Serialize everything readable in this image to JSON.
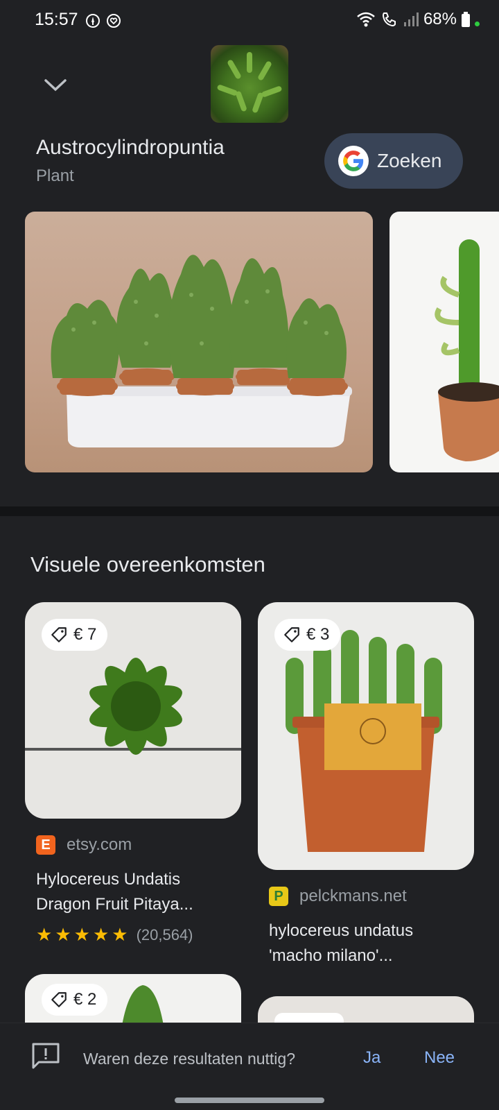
{
  "status_bar": {
    "time": "15:57",
    "battery_pct": "68%",
    "icons": [
      "notification-icon",
      "heart-icon",
      "wifi-icon",
      "wifi-calling-icon",
      "signal-icon",
      "battery-icon"
    ]
  },
  "entity": {
    "title": "Austrocylindropuntia",
    "subtitle": "Plant",
    "search_label": "Zoeken"
  },
  "visual_matches": {
    "title": "Visuele overeenkomsten",
    "items": [
      {
        "price": "€ 7",
        "source": "etsy.com",
        "favicon": "E",
        "title_line1": "Hylocereus Undatis",
        "title_line2": "Dragon Fruit Pitaya...",
        "rating_count": "(20,564)",
        "stars": 5
      },
      {
        "price": "€ 3",
        "source": "pelckmans.net",
        "favicon": "P",
        "title_line1": "hylocereus undatus",
        "title_line2": "'macho milano'..."
      },
      {
        "price": "€ 2"
      }
    ]
  },
  "feedback": {
    "question": "Waren deze resultaten nuttig?",
    "yes": "Ja",
    "no": "Nee"
  },
  "colors": {
    "background": "#202124",
    "accent": "#8ab4f8",
    "search_button": "#394457",
    "star": "#fbbc04"
  }
}
